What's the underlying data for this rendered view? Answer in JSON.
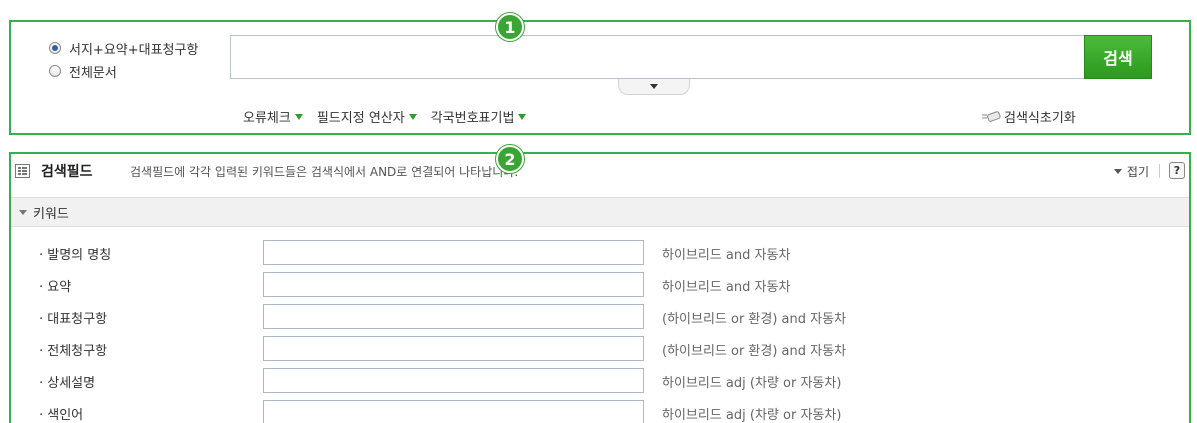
{
  "search": {
    "radio_options": [
      {
        "label": "서지+요약+대표청구항",
        "checked": true
      },
      {
        "label": "전체문서",
        "checked": false
      }
    ],
    "query_value": "",
    "button_label": "검색",
    "options": [
      {
        "label": "오류체크"
      },
      {
        "label": "필드지정 연산자"
      },
      {
        "label": "각국번호표기법"
      }
    ],
    "reset_label": "검색식초기화"
  },
  "badges": {
    "one": "1",
    "two": "2"
  },
  "field_panel": {
    "title": "검색필드",
    "description": "검색필드에 각각 입력된 키워드들은 검색식에서 AND로 연결되어 나타납니다.",
    "fold_label": "접기",
    "help_label": "?",
    "section_title": "키워드",
    "rows": [
      {
        "label": "발명의 명칭",
        "value": "",
        "example": "하이브리드 and 자동차"
      },
      {
        "label": "요약",
        "value": "",
        "example": "하이브리드 and 자동차"
      },
      {
        "label": "대표청구항",
        "value": "",
        "example": "(하이브리드 or 환경) and 자동차"
      },
      {
        "label": "전체청구항",
        "value": "",
        "example": "(하이브리드 or 환경) and 자동차"
      },
      {
        "label": "상세설명",
        "value": "",
        "example": "하이브리드 adj (차량 or 자동차)"
      },
      {
        "label": "색인어",
        "value": "",
        "example": "하이브리드 adj (차량 or 자동차)"
      }
    ]
  },
  "colors": {
    "accent": "#36b04a",
    "button": "#2b9a1e",
    "marker": "#2f9e2a"
  }
}
